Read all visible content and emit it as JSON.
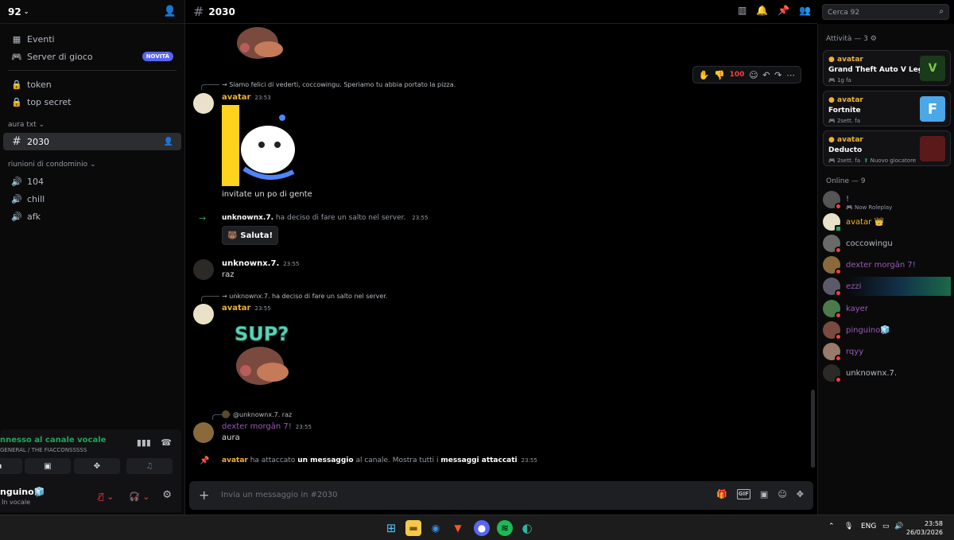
{
  "server": {
    "name": "92"
  },
  "sidebar": {
    "items": [
      {
        "label": "Eventi",
        "icon": "calendar-icon"
      },
      {
        "label": "Server di gioco",
        "icon": "gamepad-icon",
        "badge": "NOVITÀ"
      }
    ],
    "locked": [
      {
        "label": "token"
      },
      {
        "label": "top secret"
      }
    ],
    "cat1": "aura txt",
    "active_channel": "2030",
    "cat2": "riunioni di condominio",
    "voice_channels": [
      {
        "label": "104"
      },
      {
        "label": "chill"
      },
      {
        "label": "afk"
      }
    ]
  },
  "voice": {
    "title": "nnesso al canale vocale",
    "sub": "GENERAL / THE FIACCONSSSSS"
  },
  "user": {
    "name": "nguino🧊",
    "status": "In vocale"
  },
  "header": {
    "channel": "2030",
    "search_placeholder": "Cerca 92"
  },
  "messages": {
    "m0_reply": "→ Siamo felici di vederti, coccowingu. Speriamo tu abbia portato la pizza.",
    "m1_name": "avatar",
    "m1_time": "23:53",
    "m1_text": "invitate un po di gente",
    "s1_name": "unknownx.7.",
    "s1_text": "ha deciso di fare un salto nel server.",
    "s1_time": "23:55",
    "saluta": "Saluta!",
    "m2_name": "unknownx.7.",
    "m2_time": "23:55",
    "m2_text": "raz",
    "m3_reply": "→ unknownx.7. ha deciso di fare un salto nel server.",
    "m3_name": "avatar",
    "m3_time": "23:55",
    "sticker_text": "SUP?",
    "m4_reply": "@unknownx.7. raz",
    "m4_name": "dexter morgān 7!",
    "m4_time": "23:55",
    "m4_text": "aura",
    "pin_name": "avatar",
    "pin_a": "ha attaccato",
    "pin_b": "un messaggio",
    "pin_c": "al canale. Mostra tutti i",
    "pin_d": "messaggi attaccati",
    "pin_time": "23:55"
  },
  "composer": {
    "placeholder": "Invia un messaggio in #2030"
  },
  "right": {
    "activity_header": "Attività — 3",
    "activities": [
      {
        "who": "avatar",
        "game": "Grand Theft Auto V Legacy",
        "ago": "1g fa",
        "extra": ""
      },
      {
        "who": "avatar",
        "game": "Fortnite",
        "ago": "2sett. fa",
        "extra": ""
      },
      {
        "who": "avatar",
        "game": "Deducto",
        "ago": "2sett. fa",
        "extra": "Nuovo giocatore"
      }
    ],
    "online_header": "Online — 9",
    "members": [
      {
        "name": "!",
        "status": "Now Roleplay",
        "color": "#949ba4"
      },
      {
        "name": "avatar 👑",
        "status": "",
        "color": "#f0b232"
      },
      {
        "name": "coccowingu",
        "status": "",
        "color": "#b5bac1"
      },
      {
        "name": "dexter morgān 7!",
        "status": "",
        "color": "#9b59b6"
      },
      {
        "name": "ezzi",
        "status": "",
        "color": "#9b59b6"
      },
      {
        "name": "kayer",
        "status": "",
        "color": "#9b59b6"
      },
      {
        "name": "pinguino🧊",
        "status": "",
        "color": "#9b59b6"
      },
      {
        "name": "rqyy",
        "status": "",
        "color": "#9b59b6"
      },
      {
        "name": "unknownx.7.",
        "status": "",
        "color": "#b5bac1"
      }
    ]
  },
  "taskbar": {
    "lang": "ENG",
    "time": "23:58",
    "date": "26/03/2026"
  }
}
